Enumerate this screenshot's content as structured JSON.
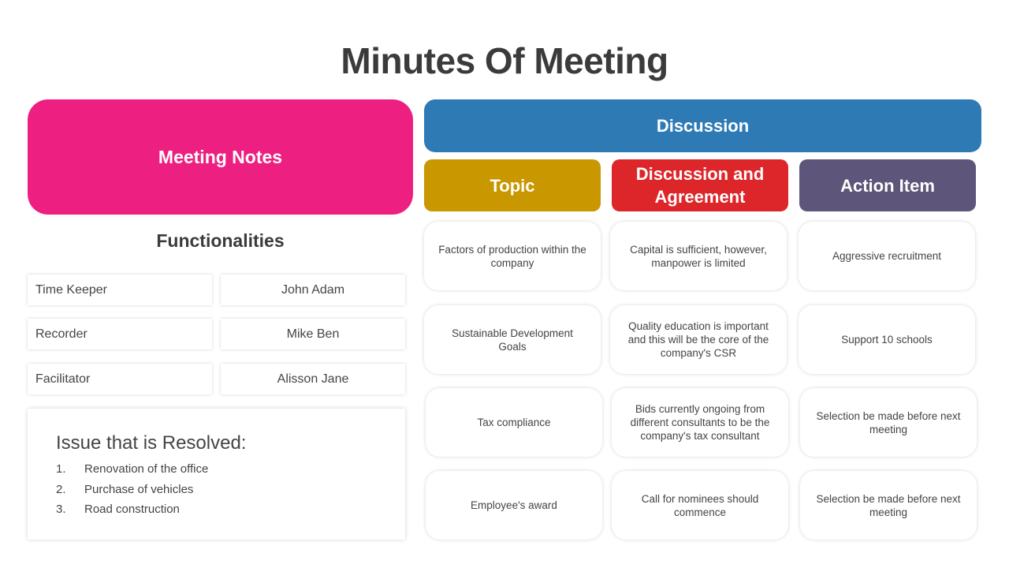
{
  "title": "Minutes Of Meeting",
  "colors": {
    "meeting_notes": "#ED1F80",
    "discussion": "#2E7AB5",
    "topic": "#C99700",
    "discussion_agreement": "#DD2629",
    "action_item": "#5E557A"
  },
  "meeting_notes": {
    "header": "Meeting Notes",
    "functionalities_title": "Functionalities",
    "roles": [
      {
        "role": "Time Keeper",
        "name": "John Adam"
      },
      {
        "role": "Recorder",
        "name": "Mike Ben"
      },
      {
        "role": "Facilitator",
        "name": "Alisson Jane"
      }
    ],
    "issues": {
      "title": "Issue that is Resolved:",
      "items": [
        {
          "num": "1.",
          "text": "Renovation of the office"
        },
        {
          "num": "2.",
          "text": "Purchase of vehicles"
        },
        {
          "num": "3.",
          "text": "Road construction"
        }
      ]
    }
  },
  "discussion": {
    "header": "Discussion",
    "columns": [
      "Topic",
      "Discussion and Agreement",
      "Action Item"
    ],
    "rows": [
      [
        "Factors of production within the company",
        "Capital is sufficient, however, manpower is limited",
        "Aggressive recruitment"
      ],
      [
        "Sustainable Development Goals",
        "Quality education is important and this will be the core of the company's CSR",
        "Support 10 schools"
      ],
      [
        "Tax compliance",
        "Bids currently ongoing from different consultants to be the company's tax consultant",
        "Selection be made before next meeting"
      ],
      [
        "Employee's award",
        "Call for nominees should commence",
        "Selection be made before next meeting"
      ]
    ]
  }
}
